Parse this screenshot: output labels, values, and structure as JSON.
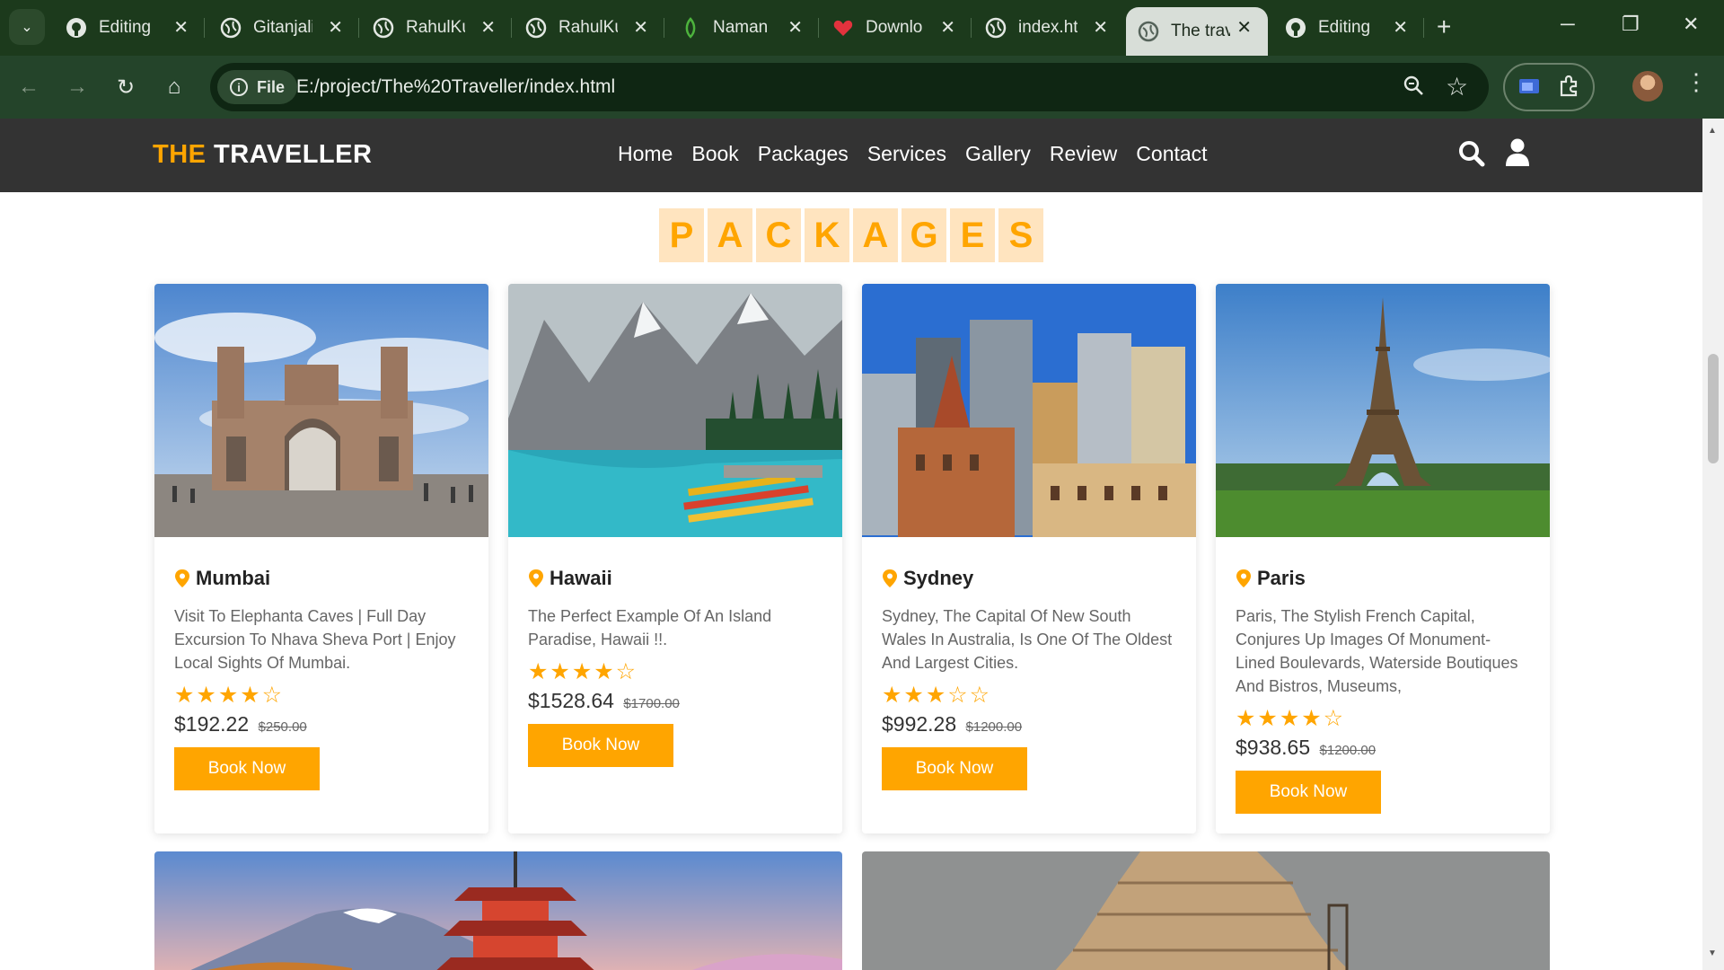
{
  "browser": {
    "tabs": [
      {
        "title": "Editing",
        "icon": "github-icon"
      },
      {
        "title": "Gitanjali",
        "icon": "globe-icon"
      },
      {
        "title": "RahulKu",
        "icon": "globe-icon"
      },
      {
        "title": "RahulKu",
        "icon": "globe-icon"
      },
      {
        "title": "Naman",
        "icon": "mongo-leaf-icon"
      },
      {
        "title": "Downlo",
        "icon": "heart-icon"
      },
      {
        "title": "index.ht",
        "icon": "globe-icon"
      },
      {
        "title": "The trav",
        "icon": "globe-icon",
        "active": true
      },
      {
        "title": "Editing",
        "icon": "github-icon"
      }
    ],
    "address": {
      "chip_label": "File",
      "url": "E:/project/The%20Traveller/index.html"
    }
  },
  "site": {
    "logo_accent": "THE",
    "logo_rest": " TRAVELLER",
    "nav": [
      "Home",
      "Book",
      "Packages",
      "Services",
      "Gallery",
      "Review",
      "Contact"
    ],
    "heading_letters": [
      "P",
      "A",
      "C",
      "K",
      "A",
      "G",
      "E",
      "S"
    ],
    "colors": {
      "accent": "#ffa500",
      "header_bg": "#333333",
      "heading_tile": "#ffe4bf"
    }
  },
  "packages": [
    {
      "title": "Mumbai",
      "desc": "Visit To Elephanta Caves | Full Day Excursion To Nhava Sheva Port | Enjoy Local Sights Of Mumbai.",
      "rating": 4,
      "stars": "★★★★☆",
      "price": "$192.22",
      "old_price": "$250.00",
      "button": "Book Now"
    },
    {
      "title": "Hawaii",
      "desc": "The Perfect Example Of An Island Paradise, Hawaii !!.",
      "rating": 4,
      "stars": "★★★★☆",
      "price": "$1528.64",
      "old_price": "$1700.00",
      "button": "Book Now"
    },
    {
      "title": "Sydney",
      "desc": "Sydney, The Capital Of New South Wales In Australia, Is One Of The Oldest And Largest Cities.",
      "rating": 3,
      "stars": "★★★☆☆",
      "price": "$992.28",
      "old_price": "$1200.00",
      "button": "Book Now"
    },
    {
      "title": "Paris",
      "desc": "Paris, The Stylish French Capital, Conjures Up Images Of Monument-Lined Boulevards, Waterside Boutiques And Bistros, Museums,",
      "rating": 4,
      "stars": "★★★★☆",
      "price": "$938.65",
      "old_price": "$1200.00",
      "button": "Book Now"
    }
  ]
}
